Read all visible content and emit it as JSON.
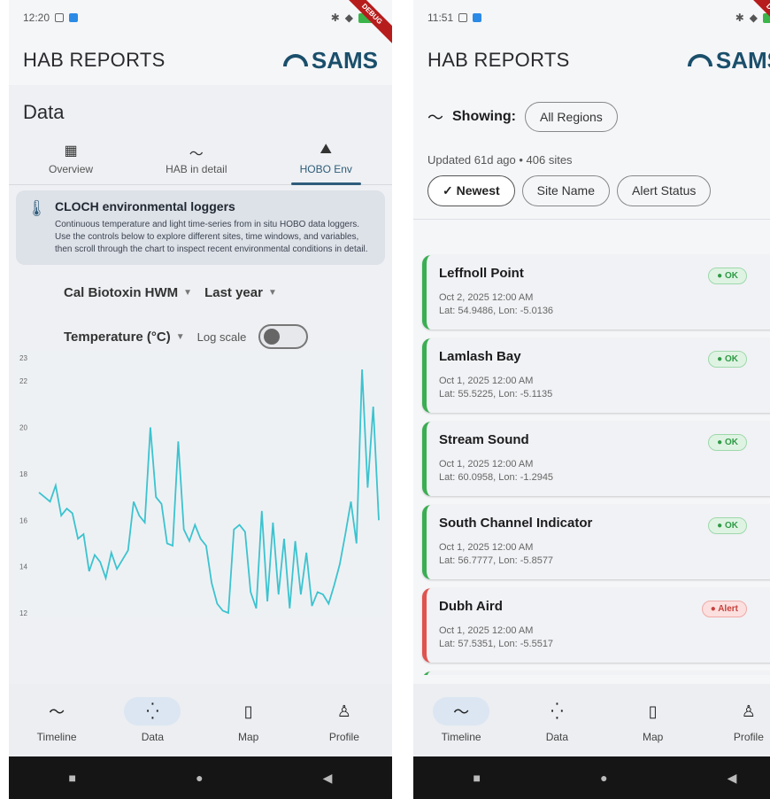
{
  "left": {
    "status": {
      "time": "12:20",
      "debug": "DEBUG"
    },
    "appbar": {
      "title": "HAB REPORTS",
      "logo": "SAMS"
    },
    "page_title": "Data",
    "tabs": [
      {
        "label": "Overview",
        "icon": "grid-add-icon"
      },
      {
        "label": "HAB in detail",
        "icon": "trend-line-icon"
      },
      {
        "label": "HOBO Env",
        "icon": "landscape-icon"
      }
    ],
    "info": {
      "title": "CLOCH environmental loggers",
      "text": "Continuous temperature and light time-series from in situ HOBO data loggers. Use the controls below to explore different sites, time windows, and variables, then scroll through the chart to inspect recent environmental conditions in detail."
    },
    "controls": {
      "site": "Cal Biotoxin HWM",
      "window": "Last year",
      "variable": "Temperature (°C)",
      "log_label": "Log scale",
      "log_on": false
    },
    "chart_data": {
      "type": "line",
      "ylim": [
        12,
        23
      ],
      "yticks": [
        "23",
        "22",
        "20",
        "18",
        "16",
        "14",
        "12"
      ],
      "values": [
        17.2,
        17.0,
        16.8,
        17.5,
        16.2,
        16.5,
        16.3,
        15.2,
        15.4,
        13.8,
        14.5,
        14.2,
        13.5,
        14.6,
        13.9,
        14.3,
        14.7,
        16.8,
        16.2,
        15.9,
        20.0,
        17.0,
        16.7,
        15.0,
        14.9,
        19.4,
        15.6,
        15.1,
        15.8,
        15.2,
        14.9,
        13.3,
        12.4,
        12.1,
        12.0,
        15.6,
        15.8,
        15.5,
        12.9,
        12.2,
        16.4,
        12.5,
        15.9,
        12.8,
        15.2,
        12.2,
        15.1,
        12.8,
        14.6,
        12.3,
        12.9,
        12.8,
        12.4,
        13.2,
        14.1,
        15.4,
        16.8,
        15.0,
        22.5,
        17.4,
        20.9,
        16.0
      ]
    },
    "nav": [
      {
        "label": "Timeline",
        "icon": "trend-line-icon"
      },
      {
        "label": "Data",
        "icon": "scatter-dots-icon",
        "active": true
      },
      {
        "label": "Map",
        "icon": "map-icon"
      },
      {
        "label": "Profile",
        "icon": "person-icon"
      }
    ]
  },
  "right": {
    "status": {
      "time": "11:51",
      "debug": "DEBUG"
    },
    "appbar": {
      "title": "HAB REPORTS",
      "logo": "SAMS"
    },
    "showing_label": "Showing:",
    "region_chip": "All Regions",
    "updated": "Updated 61d ago • 406 sites",
    "sort": [
      {
        "label": "✓ Newest",
        "selected": true
      },
      {
        "label": "Site Name",
        "selected": false
      },
      {
        "label": "Alert Status",
        "selected": false
      }
    ],
    "sites": [
      {
        "name": "Leffnoll Point",
        "date": "Oct 2, 2025 12:00 AM",
        "coords": "Lat: 54.9486, Lon: -5.0136",
        "status": "● OK",
        "alert": false
      },
      {
        "name": "Lamlash Bay",
        "date": "Oct 1, 2025 12:00 AM",
        "coords": "Lat: 55.5225, Lon: -5.1135",
        "status": "● OK",
        "alert": false
      },
      {
        "name": "Stream Sound",
        "date": "Oct 1, 2025 12:00 AM",
        "coords": "Lat: 60.0958, Lon: -1.2945",
        "status": "● OK",
        "alert": false
      },
      {
        "name": "South Channel Indicator",
        "date": "Oct 1, 2025 12:00 AM",
        "coords": "Lat: 56.7777, Lon: -5.8577",
        "status": "● OK",
        "alert": false
      },
      {
        "name": "Dubh Aird",
        "date": "Oct 1, 2025 12:00 AM",
        "coords": "Lat: 57.5351, Lon: -5.5517",
        "status": "● Alert",
        "alert": true
      }
    ],
    "nav": [
      {
        "label": "Timeline",
        "icon": "trend-line-icon",
        "active": true
      },
      {
        "label": "Data",
        "icon": "scatter-dots-icon"
      },
      {
        "label": "Map",
        "icon": "map-icon"
      },
      {
        "label": "Profile",
        "icon": "person-icon"
      }
    ]
  }
}
